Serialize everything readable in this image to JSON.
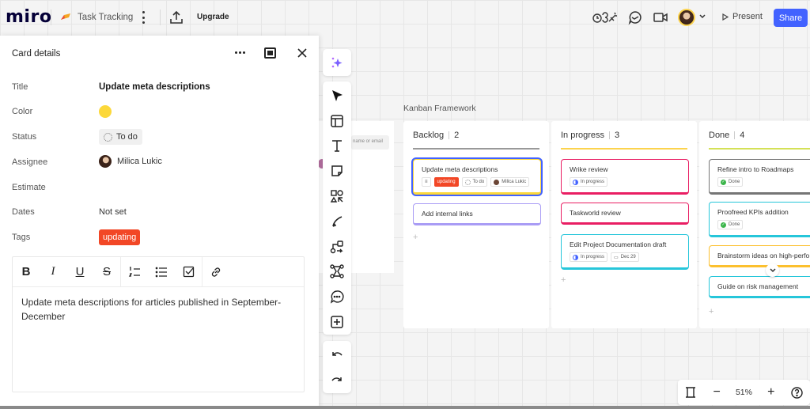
{
  "app": {
    "logo": "miro",
    "board_title": "Task Tracking",
    "upgrade_label": "Upgrade",
    "present_label": "Present",
    "share_label": "Share",
    "brand_color": "#4262ff"
  },
  "panel": {
    "title": "Card details",
    "fields": {
      "title_label": "Title",
      "title_value": "Update meta descriptions",
      "color_label": "Color",
      "color_value": "#fcd83a",
      "status_label": "Status",
      "status_value": "To do",
      "assignee_label": "Assignee",
      "assignee_value": "Milica Lukic",
      "estimate_label": "Estimate",
      "estimate_value": "",
      "dates_label": "Dates",
      "dates_value": "Not set",
      "tags_label": "Tags",
      "tags_value": "updating"
    },
    "editor": {
      "toolbar": [
        "bold-icon",
        "italic-icon",
        "underline-icon",
        "strikethrough-icon",
        "numbered-list-icon",
        "bullet-list-icon",
        "checklist-icon",
        "link-icon"
      ],
      "text": "Update meta descriptions for articles published in September-December"
    }
  },
  "share_popup_ghost": {
    "input_placeholder": "name or email"
  },
  "kanban": {
    "title": "Kanban Framework",
    "columns": [
      {
        "name": "Backlog",
        "count": "2",
        "line_color": "#999999",
        "cards": [
          {
            "title": "Update meta descriptions",
            "tag": "updating",
            "status": "To do",
            "assignee": "Milica Lukic",
            "color": "#fcd83a",
            "selected": true
          },
          {
            "title": "Add internal links",
            "color": "#a99cf5"
          }
        ]
      },
      {
        "name": "In progress",
        "count": "3",
        "line_color": "#fcd34d",
        "cards": [
          {
            "title": "Wrike review",
            "status": "In progress",
            "color": "#e91e63"
          },
          {
            "title": "Taskworld review",
            "color": "#e91e63"
          },
          {
            "title": "Edit Project Documentation draft",
            "status": "In progress",
            "date": "Dec 29",
            "color": "#26c6da"
          }
        ]
      },
      {
        "name": "Done",
        "count": "4",
        "line_color": "#d4e157",
        "cards": [
          {
            "title": "Refine intro to Roadmaps",
            "status": "Done",
            "color": "#757575"
          },
          {
            "title": "Proofreed KPIs addition",
            "status": "Done",
            "color": "#26c6da"
          },
          {
            "title": "Brainstorm ideas on high-perfo",
            "color": "#fcc02e"
          },
          {
            "title": "Guide on risk management",
            "color": "#26c6da"
          }
        ]
      }
    ],
    "add_label": "+"
  },
  "zoom": {
    "value": "51%"
  }
}
